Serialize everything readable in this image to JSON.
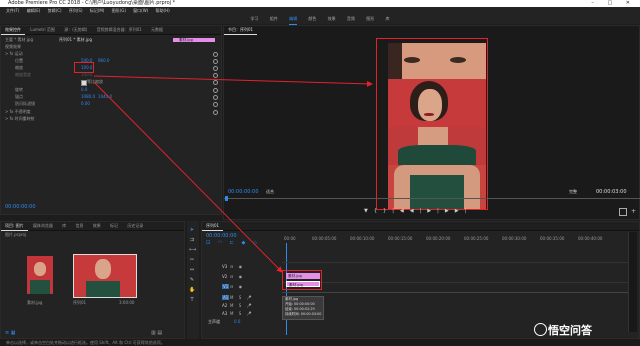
{
  "app": {
    "title": "Adobe Premiere Pro CC 2018 - C:\\用户\\Luoyudong\\桌面\\图片.prproj *",
    "window_controls": [
      "–",
      "□",
      "✕"
    ]
  },
  "menu": [
    "文件(F)",
    "编辑(E)",
    "剪辑(C)",
    "序列(S)",
    "标记(M)",
    "图形(G)",
    "窗口(W)",
    "帮助(H)"
  ],
  "workspaces": [
    "学习",
    "组件",
    "编辑",
    "颜色",
    "效果",
    "音频",
    "图形",
    "库"
  ],
  "active_workspace_index": 2,
  "effect_controls": {
    "tabs": [
      "效果控件",
      "Lumetri 范围",
      "源：(无剪辑)",
      "音频剪辑混合器：序列01",
      "元数据"
    ],
    "master_label": "主要 * 素材.jpg",
    "sequence_label": "序列01 * 素材.jpg",
    "section_video": "视频效果",
    "fx_motion": "运动",
    "position_label": "位置",
    "position_x": "540.0",
    "position_y": "960.0",
    "scale_label": "缩放",
    "scale_value": "100.0",
    "scale_width_label": "缩放宽度",
    "uniform_label": "等比缩放",
    "rotation_label": "旋转",
    "rotation_value": "0.0",
    "anchor_label": "锚点",
    "anchor_x": "1080.0",
    "anchor_y": "1440.0",
    "antiflicker_label": "防闪烁滤镜",
    "antiflicker_value": "0.00",
    "opacity_label": "不透明度",
    "time_remap_label": "时间重映射",
    "clip_name": "素材.jpg",
    "timecode": "00:00:00:00"
  },
  "program": {
    "title": "节目：序列01",
    "timecode_left": "00:00:00:00",
    "fit_label": "适合",
    "quality_label": "完整",
    "timecode_right": "00:00:03:00"
  },
  "project": {
    "tabs": [
      "项目: 图片",
      "媒体浏览器",
      "库",
      "信息",
      "效果",
      "标记",
      "历史记录"
    ],
    "project_file": "图片.prproj",
    "items": [
      {
        "name": "素材.jpg",
        "duration": ""
      },
      {
        "name": "序列01",
        "duration": "3:00:00"
      }
    ]
  },
  "timeline": {
    "tab": "序列01",
    "timecode": "00:00:00:00",
    "ruler": [
      "00:00",
      "00:00:05:00",
      "00:00:10:00",
      "00:00:15:00",
      "00:00:20:00",
      "00:00:25:00",
      "00:00:30:00",
      "00:00:35:00",
      "00:00:40:00"
    ],
    "tracks": [
      "V3",
      "V2",
      "V1",
      "A1",
      "A2",
      "A3"
    ],
    "master_label": "主声道",
    "master_value": "0.0",
    "clip_top": "素材.jpg",
    "clip_bottom": "素材.jpg",
    "tooltip": {
      "name": "素材.jpg",
      "start": "开始: 00:00:00:00",
      "end": "结束: 00:00:02:29",
      "duration": "持续时间: 00:00:03:00"
    }
  },
  "status": "单击以选择，或单击空白处并拖动以进行框选。使用 Shift、Alt 和 Ctrl 可获得其他选项。",
  "watermark": "悟空问答",
  "colors": {
    "accent": "#2d8ceb",
    "clip_pink": "#e58ee7",
    "annotation_red": "#e2232a",
    "panel_bg": "#232323"
  }
}
